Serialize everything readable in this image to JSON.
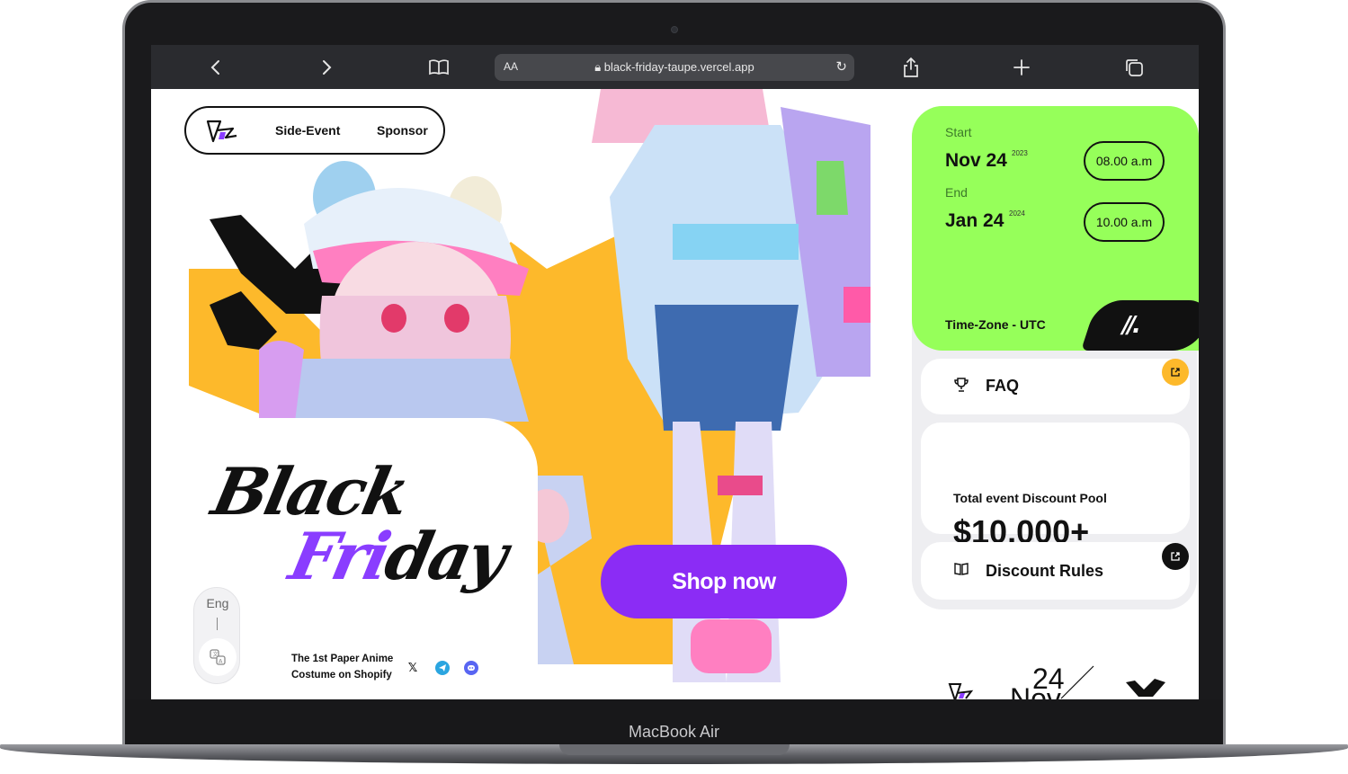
{
  "device": {
    "model_label": "MacBook Air"
  },
  "browser": {
    "url_prefix": "AA",
    "url": "black-friday-taupe.vercel.app",
    "icons": [
      "back-icon",
      "forward-icon",
      "bookmarks-icon",
      "lock-icon",
      "reload-icon",
      "share-icon",
      "new-tab-icon",
      "tabs-icon"
    ]
  },
  "nav": {
    "items": [
      {
        "label": "Side-Event"
      },
      {
        "label": "Sponsor"
      }
    ]
  },
  "hero": {
    "title_line1": "Black",
    "title_line2_accent": "Fri",
    "title_line2_rest": "day",
    "shop_button": "Shop now",
    "tagline": "The 1st Paper Anime Costume on Shopify",
    "language": "Eng",
    "language_separator": "|"
  },
  "schedule": {
    "start_label": "Start",
    "start_date": "Nov 24",
    "start_year": "2023",
    "start_time": "08.00 a.m",
    "end_label": "End",
    "end_date": "Jan 24",
    "end_year": "2024",
    "end_time": "10.00 a.m",
    "timezone": "Time-Zone - UTC"
  },
  "cards": {
    "faq": "FAQ",
    "pool_label": "Total event Discount Pool",
    "pool_value": "$10.000+",
    "rules": "Discount Rules"
  },
  "footer": {
    "day": "24",
    "month": "Nov"
  },
  "colors": {
    "accent_purple": "#8b2cf5",
    "accent_green": "#96ff5a",
    "accent_yellow": "#fdb92b",
    "dark": "#111111"
  }
}
